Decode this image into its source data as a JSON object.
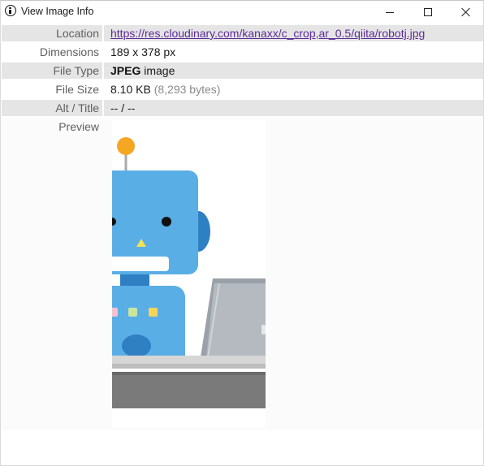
{
  "window": {
    "title": "View Image Info"
  },
  "info": {
    "location_label": "Location",
    "location_value": "https://res.cloudinary.com/kanaxx/c_crop,ar_0.5/qiita/robotj.jpg",
    "dimensions_label": "Dimensions",
    "dimensions_value": "189 x 378 px",
    "filetype_label": "File Type",
    "filetype_bold": "JPEG",
    "filetype_rest": " image",
    "filesize_label": "File Size",
    "filesize_value": "8.10 KB",
    "filesize_bytes": "(8,293 bytes)",
    "alt_label": "Alt / Title",
    "alt_value": "-- / --",
    "preview_label": "Preview"
  },
  "icons": {
    "app": "info-circle-icon",
    "minimize": "minimize-icon",
    "maximize": "maximize-icon",
    "close": "close-icon"
  },
  "colors": {
    "link": "#5d2c99",
    "row_shade": "#e5e5e5",
    "label_text": "#5f5f5f",
    "robot_blue": "#5aaee6",
    "robot_dark_blue": "#2f7fc3",
    "antenna_orange": "#f5a623",
    "desk_gray": "#7a7a7a",
    "laptop_gray": "#9aa1a8"
  }
}
